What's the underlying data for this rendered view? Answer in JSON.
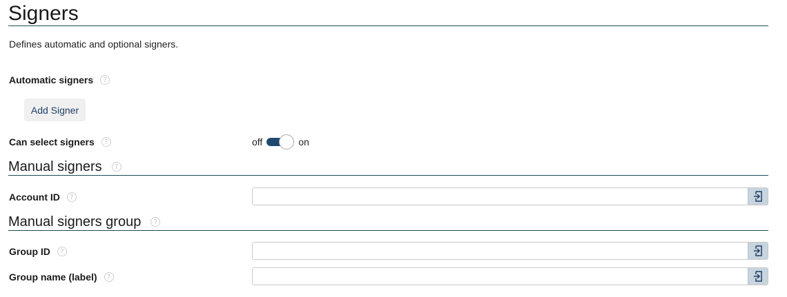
{
  "page": {
    "title": "Signers",
    "description": "Defines automatic and optional signers."
  },
  "automatic_signers": {
    "label": "Automatic signers",
    "help": "?",
    "add_button": "Add Signer"
  },
  "can_select": {
    "label": "Can select signers",
    "help": "?",
    "off_label": "off",
    "on_label": "on",
    "state": "on"
  },
  "manual_signers": {
    "heading": "Manual signers",
    "help": "?",
    "account_id": {
      "label": "Account ID",
      "help": "?",
      "value": "",
      "icon": "select-entry-icon"
    }
  },
  "manual_signers_group": {
    "heading": "Manual signers group",
    "help": "?",
    "group_id": {
      "label": "Group ID",
      "help": "?",
      "value": "",
      "icon": "select-entry-icon"
    },
    "group_name": {
      "label": "Group name (label)",
      "help": "?",
      "value": "",
      "icon": "select-entry-icon"
    }
  },
  "colors": {
    "accent": "#1f4a6e",
    "rule": "#1f4a55",
    "button_text": "#1f3f66",
    "addon_bg": "#c8d4de"
  }
}
